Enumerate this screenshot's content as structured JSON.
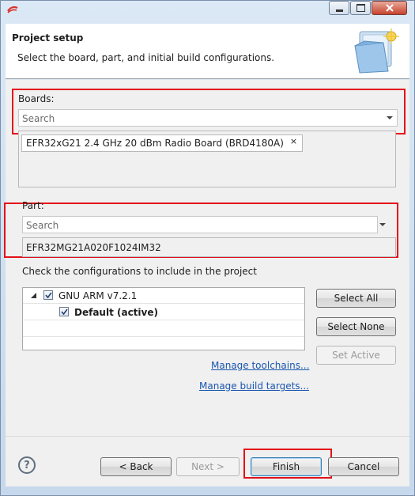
{
  "header": {
    "title": "Project setup",
    "description": "Select the board, part, and initial build configurations."
  },
  "boards": {
    "label": "Boards:",
    "search_placeholder": "Search",
    "selected": [
      {
        "label": "EFR32xG21 2.4 GHz 20 dBm Radio Board (BRD4180A)",
        "remove": "×"
      }
    ]
  },
  "part": {
    "label": "Part:",
    "search_placeholder": "Search",
    "value": "EFR32MG21A020F1024IM32"
  },
  "configurations": {
    "label": "Check the configurations to include in the project",
    "tree": [
      {
        "label": "GNU ARM v7.2.1",
        "checked": true,
        "expanded": true,
        "children": [
          {
            "label": "Default (active)",
            "checked": true,
            "bold": true
          }
        ]
      }
    ],
    "buttons": {
      "select_all": "Select All",
      "select_none": "Select None",
      "set_active": "Set Active"
    },
    "links": {
      "manage_toolchains": "Manage toolchains...",
      "manage_build_targets": "Manage build targets..."
    }
  },
  "footer": {
    "help": "?",
    "back": "< Back",
    "next": "Next >",
    "finish": "Finish",
    "cancel": "Cancel"
  },
  "colors": {
    "highlight_box": "#e3101a",
    "link": "#1a56b0",
    "brand_icon": "#d9322c"
  }
}
